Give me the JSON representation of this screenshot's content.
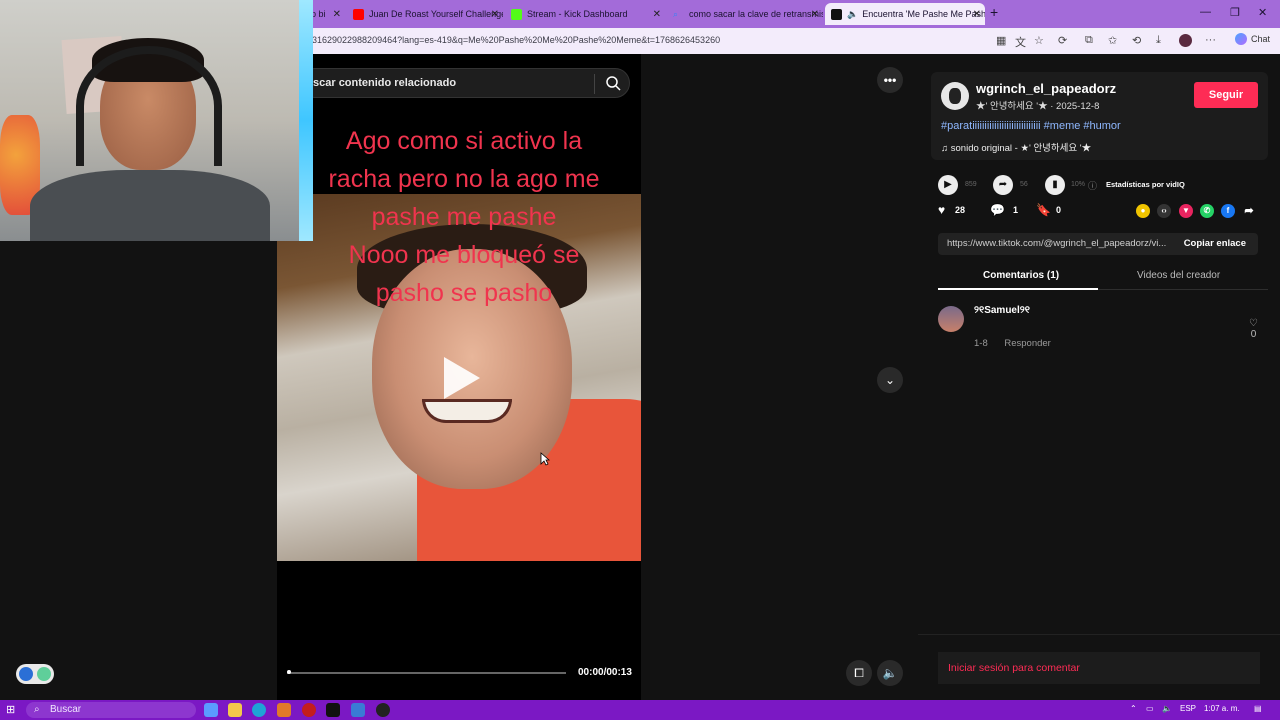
{
  "browser": {
    "tabs": [
      {
        "label": "p bi",
        "icon_color": "#999999"
      },
      {
        "label": "Juan De Roast Yourself Challenge",
        "icon_color": "#ff0000"
      },
      {
        "label": "Stream - Kick Dashboard",
        "icon_color": "#53fc18"
      },
      {
        "label": "como sacar la clave de retransmisi",
        "icon_color": "#3b82f6"
      },
      {
        "label": "Encuentra 'Me Pashe Me Pash",
        "icon_color": "#111111"
      }
    ],
    "new_tab": "+",
    "url": "3162902298820946​4?lang=es-419&q=Me%20Pashe%20Me%20Pashe%20Meme&t=1768626453260",
    "chat_label": "Chat"
  },
  "video": {
    "search_placeholder": "scar contenido relacionado",
    "caption_lines": [
      "Ago como si activo la",
      "racha pero no la ago me",
      "pashe me pashe",
      "Nooo me bloqueó se",
      "pasho se pasho"
    ],
    "time": "00:00/00:13",
    "progress": 0.0
  },
  "creator": {
    "username": "wgrinch_el_papeadorz",
    "subline": "★' 안녕하세요 '★ · 2025-12-8",
    "follow_label": "Seguir",
    "hashtags": "#paratiiiiiiiiiiiiiiiiiiiiiiiiiiii #meme #humor",
    "sound": "sonido original - ★' 안녕하세요 '★"
  },
  "stats": {
    "plays": "859",
    "shares": "56",
    "percent": "10%",
    "vidiq_label": "Estadísticas por vidIQ",
    "likes": "28",
    "comments": "1",
    "saves": "0"
  },
  "link": {
    "url": "https://www.tiktok.com/@wgrinch_el_papeadorz/vi...",
    "copy_label": "Copiar enlace"
  },
  "tabs": {
    "comments": "Comentarios (1)",
    "creator_videos": "Videos del creador"
  },
  "comment": {
    "name": "୨୧Samuel୨୧",
    "date": "1-8",
    "reply": "Responder",
    "likes": "0"
  },
  "login_label": "Iniciar sesión para comentar",
  "taskbar": {
    "search_label": "Buscar",
    "lang": "ESP",
    "clock": "1:07 a. m."
  }
}
